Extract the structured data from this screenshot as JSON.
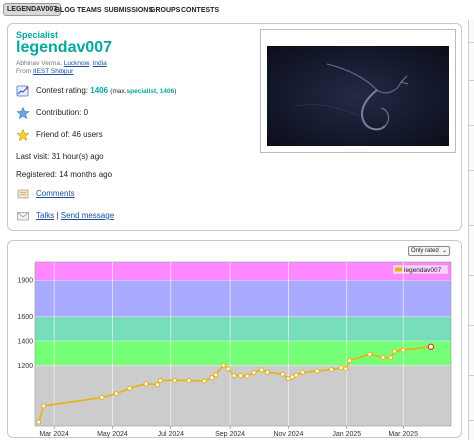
{
  "nav": {
    "items": [
      {
        "label": "LEGENDAV007",
        "active": true
      },
      {
        "label": "BLOG"
      },
      {
        "label": "TEAMS"
      },
      {
        "label": "SUBMISSIONS"
      },
      {
        "label": "GROUPS"
      },
      {
        "label": "CONTESTS"
      }
    ]
  },
  "profile": {
    "rank": "Specialist",
    "handle": "legendav007",
    "name": "Abhinav Verma,",
    "city": "Lucknow",
    "country": "India",
    "from_label": "From",
    "organization": "IIEST Shibpur",
    "rating_label": "Contest rating:",
    "rating_value": "1406",
    "rating_max_prefix": "(max.",
    "rating_max_rank": "specialist, 1406",
    "rating_max_suffix": ")",
    "contribution_label": "Contribution:",
    "contribution_value": "0",
    "friend_label": "Friend of: 46 users",
    "last_visit": "Last visit: 31 hour(s) ago",
    "registered": "Registered: 14 months ago",
    "comments_link": "Comments",
    "talks_link": "Talks",
    "separator": "|",
    "send_message_link": "Send message",
    "colors": {
      "accent": "#03a89e",
      "link": "#1a4fa0"
    }
  },
  "chart_controls": {
    "filter_selected": "Only rated"
  },
  "chart_data": {
    "type": "line",
    "series": [
      {
        "name": "legendav007",
        "color": "#e8b10e",
        "x": [
          "2024-02-14",
          "2024-02-19",
          "2024-04-20",
          "2024-05-05",
          "2024-05-19",
          "2024-06-05",
          "2024-06-17",
          "2024-06-20",
          "2024-07-05",
          "2024-07-20",
          "2024-08-05",
          "2024-08-13",
          "2024-08-17",
          "2024-08-25",
          "2024-08-30",
          "2024-09-05",
          "2024-09-12",
          "2024-09-19",
          "2024-09-26",
          "2024-10-04",
          "2024-10-10",
          "2024-10-26",
          "2024-11-01",
          "2024-11-05",
          "2024-11-09",
          "2024-11-16",
          "2024-12-01",
          "2024-12-16",
          "2024-12-26",
          "2024-12-31",
          "2025-01-04",
          "2025-01-25",
          "2025-02-08",
          "2025-02-16",
          "2025-02-20",
          "2025-03-01",
          "2025-03-30"
        ],
        "values": [
          732,
          865,
          935,
          967,
          1010,
          1048,
          1040,
          1075,
          1076,
          1075,
          1070,
          1098,
          1122,
          1200,
          1170,
          1116,
          1115,
          1110,
          1140,
          1162,
          1142,
          1126,
          1090,
          1104,
          1118,
          1142,
          1152,
          1164,
          1180,
          1170,
          1238,
          1290,
          1265,
          1262,
          1315,
          1325,
          1352
        ]
      }
    ],
    "x_ticks": [
      "Mar 2024",
      "May 2024",
      "Jul 2024",
      "Sep 2024",
      "Nov 2024",
      "Jan 2025",
      "Mar 2025"
    ],
    "x_tick_dates": [
      "2024-03-01",
      "2024-05-01",
      "2024-07-01",
      "2024-09-01",
      "2024-11-01",
      "2025-01-01",
      "2025-03-01"
    ],
    "y_ticks": [
      1200,
      1400,
      1600,
      1900
    ],
    "ylim": [
      700,
      2050
    ],
    "xlim": [
      "2024-02-10",
      "2025-04-20"
    ],
    "bands": [
      {
        "from": 700,
        "to": 1200,
        "color": "#cccccc"
      },
      {
        "from": 1200,
        "to": 1400,
        "color": "#77ff77"
      },
      {
        "from": 1400,
        "to": 1600,
        "color": "#77ddbb"
      },
      {
        "from": 1600,
        "to": 1900,
        "color": "#aaaaff"
      },
      {
        "from": 1900,
        "to": 2050,
        "color": "#ff88ff"
      }
    ],
    "grid": true,
    "legend": "top-right",
    "title": "",
    "xlabel": "",
    "ylabel": ""
  }
}
